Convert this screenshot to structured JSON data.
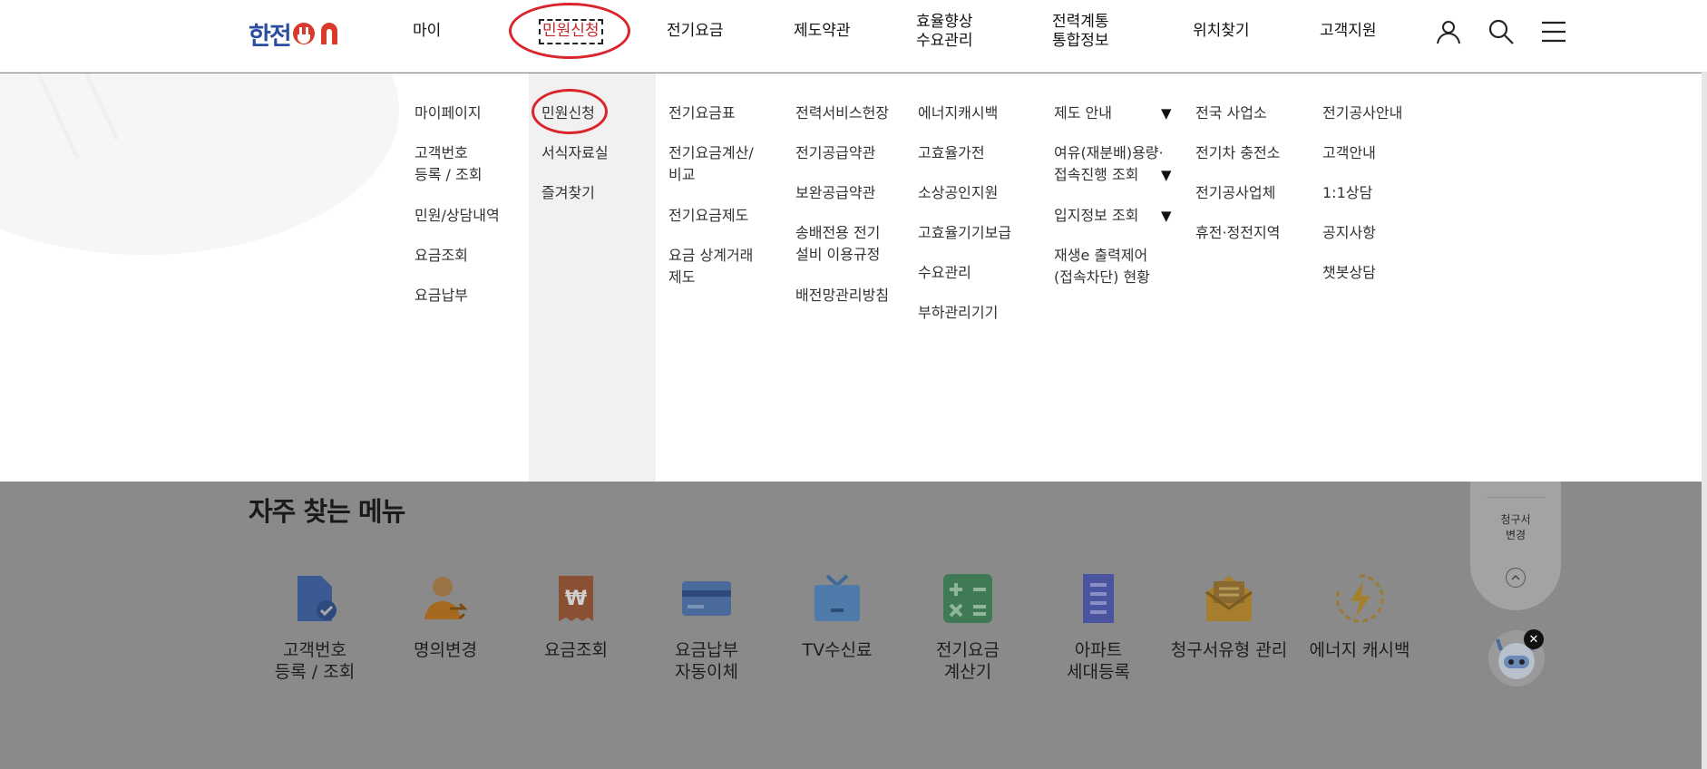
{
  "header": {
    "logo_ko": "한전",
    "logo_on": "ON",
    "nav": [
      {
        "label": "마이"
      },
      {
        "label": "민원신청"
      },
      {
        "label": "전기요금"
      },
      {
        "label": "제도약관"
      },
      {
        "label": "효율향상\n수요관리"
      },
      {
        "label": "전력계통\n통합정보"
      },
      {
        "label": "위치찾기"
      },
      {
        "label": "고객지원"
      }
    ],
    "icons": [
      "user-icon",
      "search-icon",
      "hamburger-menu-icon"
    ]
  },
  "mega_menu": {
    "columns": [
      {
        "items": [
          "마이페이지",
          "고객번호\n등록 / 조회",
          "민원/상담내역",
          "요금조회",
          "요금납부"
        ]
      },
      {
        "items": [
          "민원신청",
          "서식자료실",
          "즐겨찾기"
        ]
      },
      {
        "items": [
          "전기요금표",
          "전기요금계산/\n비교",
          "전기요금제도",
          "요금 상계거래\n제도"
        ]
      },
      {
        "items": [
          "전력서비스헌장",
          "전기공급약관",
          "보완공급약관",
          "송배전용 전기\n설비 이용규정",
          "배전망관리방침"
        ]
      },
      {
        "items": [
          "에너지캐시백",
          "고효율가전",
          "소상공인지원",
          "고효율기기보급",
          "수요관리",
          "부하관리기기"
        ]
      },
      {
        "items": [
          "제도 안내",
          "여유(재분배)용량·\n접속진행 조회",
          "입지정보 조회",
          "재생e 출력제어\n(접속차단) 현황"
        ],
        "arrow": "▼"
      },
      {
        "items": [
          "전국 사업소",
          "전기차 충전소",
          "전기공사업체",
          "휴전·정전지역"
        ]
      },
      {
        "items": [
          "전기공사안내",
          "고객안내",
          "1:1상담",
          "공지사항",
          "챗봇상담"
        ]
      }
    ]
  },
  "quick_menu": {
    "title": "자주 찾는 메뉴",
    "items": [
      {
        "label": "고객번호\n등록 / 조회",
        "icon": "document-check-icon"
      },
      {
        "label": "명의변경",
        "icon": "person-transfer-icon"
      },
      {
        "label": "요금조회",
        "icon": "receipt-won-icon"
      },
      {
        "label": "요금납부\n자동이체",
        "icon": "credit-card-icon"
      },
      {
        "label": "TV수신료",
        "icon": "tv-icon"
      },
      {
        "label": "전기요금\n계산기",
        "icon": "calculator-icon"
      },
      {
        "label": "아파트\n세대등록",
        "icon": "apartment-icon"
      },
      {
        "label": "청구서유형 관리",
        "icon": "mail-icon"
      },
      {
        "label": "에너지 캐시백",
        "icon": "energy-bolt-icon"
      }
    ]
  },
  "floating": {
    "bill_change_label": "청구서\n변경",
    "close": "✕"
  },
  "colors": {
    "brand_blue": "#2a4f9e",
    "brand_red": "#d93a2b",
    "highlight_red": "#d8262c"
  }
}
